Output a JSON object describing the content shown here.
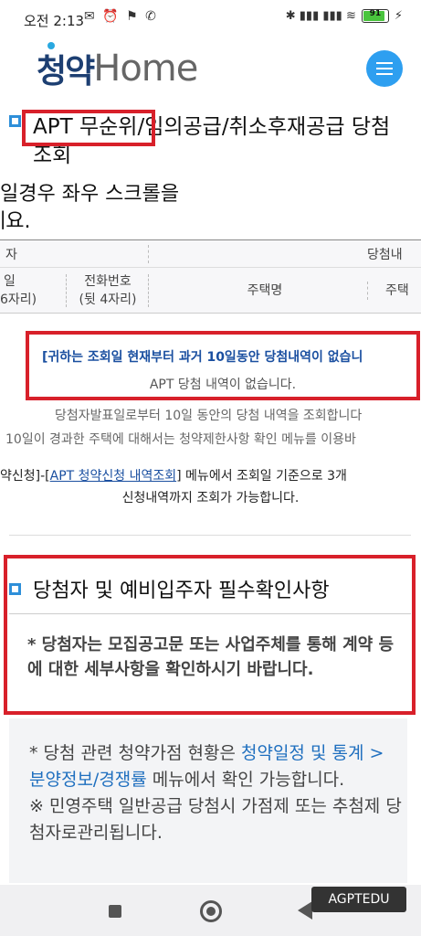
{
  "status": {
    "time": "오전 2:13",
    "left_icons": "✉ ⏰ ⚑ ✆",
    "right_icons": "✱ ▮▮▮ ▮▮▮ ≋",
    "battery": "91",
    "battery_level": 0.91
  },
  "header": {
    "logo_korean": "청약",
    "logo_home": "Home",
    "menu_icon": "hamburger-icon",
    "brand_color": "#2e9ff0"
  },
  "section1": {
    "title": "APT 무순위/임의공급/취소후재공급 당첨조회",
    "scroll_hint_line1": "일경우 좌우 스크롤을",
    "scroll_hint_line2": "세요."
  },
  "table": {
    "header1_left": "자",
    "header1_right": "당첨내",
    "col1_line1": "일",
    "col1_line2": "6자리)",
    "col2_line1": "전화번호",
    "col2_line2": "(뒷 4자리)",
    "col3": "주택명",
    "col4": "주택"
  },
  "notice": {
    "red_line": "[귀하는 조회일 현재부터 과거 10일동안 당첨내역이 없습니",
    "none_line": "APT 당첨 내역이 없습니다.",
    "info1": "당첨자발표일로부터 10일 동안의 당첨 내역을 조회합니다",
    "info2": "10일이 경과한 주택에 대해서는 청약제한사항 확인 메뉴를 이용바",
    "info3_prefix": "약신청]-[",
    "info3_link": "APT 청약신청 내역조회",
    "info3_suffix": "] 메뉴에서 조회일 기준으로 3개",
    "info4": "신청내역까지 조회가 가능합니다."
  },
  "section2": {
    "title": "당첨자 및 예비입주자 필수확인사항",
    "body": "* 당첨자는 모집공고문 또는 사업주체를 통해 계약 등에 대한 세부사항을 확인하시기 바랍니다."
  },
  "extra": {
    "line1_prefix": "* 당첨 관련 청약가점 현황은 ",
    "line1_link": "청약일정 및 통계 > 분양정보/경쟁률",
    "line1_suffix": " 메뉴에서 확인 가능합니다.",
    "line2": "※ 민영주택 일반공급 당첨시 가점제 또는 추첨제 당첨자로관리됩니다."
  },
  "watermark": "AGPTEDU"
}
